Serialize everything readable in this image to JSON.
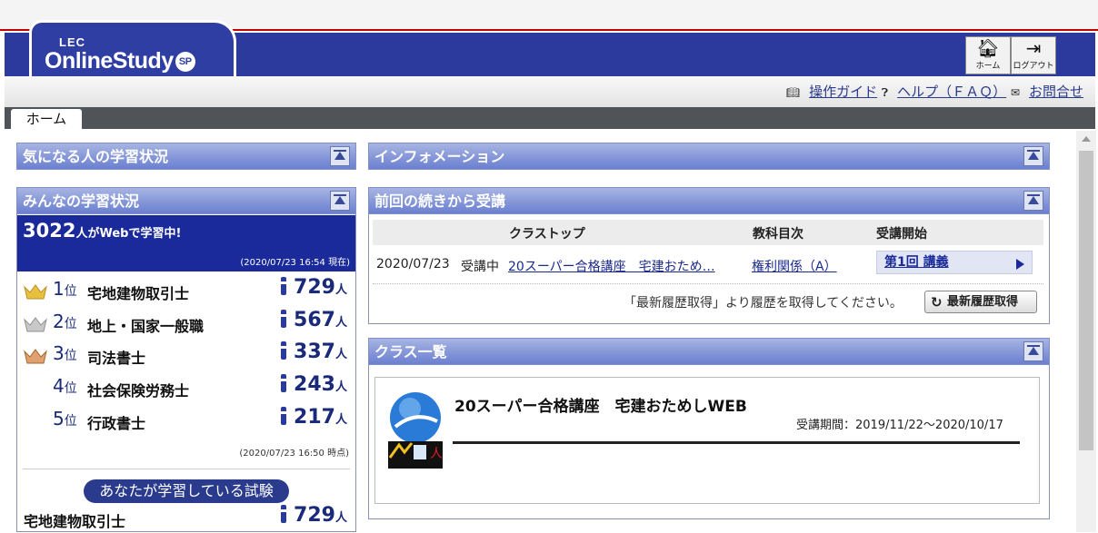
{
  "header": {
    "logo_top": "LEC",
    "logo_main": "OnlineStudy",
    "logo_badge": "SP",
    "home_label": "ホーム",
    "logout_label": "ログアウト"
  },
  "links": {
    "guide": "操作ガイド",
    "help": "ヘルプ（ＦＡＱ）",
    "contact": "お問合せ"
  },
  "tabs": [
    "ホーム"
  ],
  "panels": {
    "watched": "気になる人の学習状況",
    "everyone": "みんなの学習状況",
    "info": "インフォメーション",
    "resume": "前回の続きから受講",
    "classlist": "クラス一覧"
  },
  "everyone": {
    "count": "3022",
    "count_suffix": "人がWebで学習中!",
    "timestamp": "(2020/07/23 16:54 現在)",
    "ranking": [
      {
        "rank": "1",
        "rank_suffix": "位",
        "name": "宅地建物取引士",
        "count": "729",
        "unit": "人",
        "crown": "gold"
      },
      {
        "rank": "2",
        "rank_suffix": "位",
        "name": "地上・国家一般職",
        "count": "567",
        "unit": "人",
        "crown": "silver"
      },
      {
        "rank": "3",
        "rank_suffix": "位",
        "name": "司法書士",
        "count": "337",
        "unit": "人",
        "crown": "bronze"
      },
      {
        "rank": "4",
        "rank_suffix": "位",
        "name": "社会保険労務士",
        "count": "243",
        "unit": "人",
        "crown": ""
      },
      {
        "rank": "5",
        "rank_suffix": "位",
        "name": "行政書士",
        "count": "217",
        "unit": "人",
        "crown": ""
      }
    ],
    "ranking_timestamp": "(2020/07/23 16:50 時点)",
    "your_exam_label": "あなたが学習している試験",
    "your_exam": {
      "name": "宅地建物取引士",
      "count": "729",
      "unit": "人"
    }
  },
  "resume": {
    "columns": [
      "クラストップ",
      "教科目次",
      "受講開始"
    ],
    "row": {
      "date": "2020/07/23",
      "status": "受講中",
      "class_link": "20スーパー合格講座　宅建おため…",
      "subject_link": "権利関係（A）",
      "start_label": "第1回 講義"
    },
    "history_message": "「最新履歴取得」より履歴を取得してください。",
    "history_button": "最新履歴取得"
  },
  "classlist": {
    "title": "20スーパー合格講座　宅建おためしWEB",
    "period": "受講期間：2019/11/22～2020/10/17"
  },
  "colors": {
    "brand_blue": "#2b3a9c",
    "accent_red": "#c40000",
    "panel_header": "#7b8fd6"
  }
}
